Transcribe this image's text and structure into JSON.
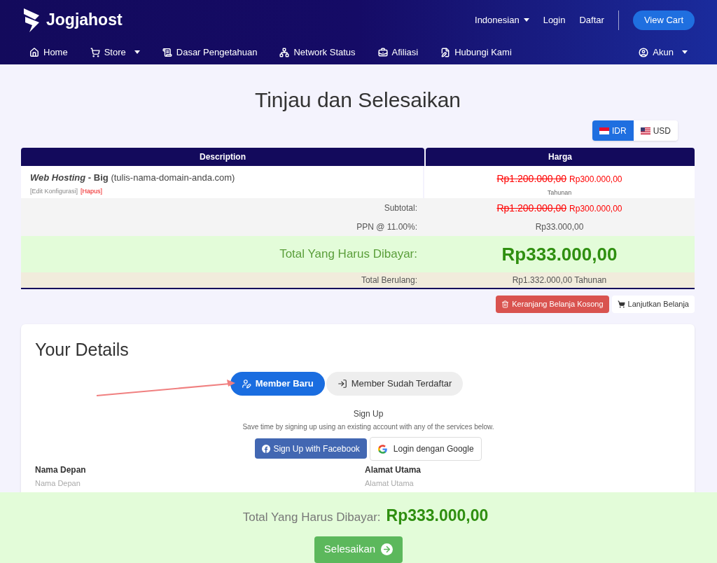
{
  "header": {
    "logo": "Jogjahost",
    "top_links": [
      {
        "label": "Indonesian",
        "dropdown": true
      },
      {
        "label": "Login",
        "dropdown": false
      },
      {
        "label": "Daftar",
        "dropdown": false
      }
    ],
    "view_cart": "View Cart"
  },
  "nav": {
    "items": [
      {
        "label": "Home",
        "kind": "home",
        "dropdown": false
      },
      {
        "label": "Store",
        "kind": "cart",
        "dropdown": true
      },
      {
        "label": "Dasar Pengetahuan",
        "kind": "scroll",
        "dropdown": false
      },
      {
        "label": "Network Status",
        "kind": "network",
        "dropdown": false
      },
      {
        "label": "Afiliasi",
        "kind": "briefcase",
        "dropdown": false
      },
      {
        "label": "Hubungi Kami",
        "kind": "edit",
        "dropdown": false
      }
    ],
    "account": {
      "label": "Akun",
      "dropdown": true
    }
  },
  "title": "Tinjau dan Selesaikan",
  "currencies": [
    {
      "label": "IDR",
      "selected": true,
      "kind": "id"
    },
    {
      "label": "USD",
      "selected": false,
      "kind": "us"
    }
  ],
  "table": {
    "columns": [
      "Description",
      "Harga"
    ],
    "item": {
      "name": "Web Hosting",
      "separator": "-",
      "variant": "Big",
      "domain": "(tulis-nama-domain-anda.com)",
      "edit": "[Edit Konfigurasi]",
      "remove": "[Hapus]",
      "old_price": "Rp1.200.000,00",
      "price": "Rp300.000,00",
      "cycle": "Tahunan"
    },
    "subtotal": {
      "label": "Subtotal:",
      "old_price": "Rp1.200.000,00",
      "price": "Rp300.000,00"
    },
    "tax": {
      "label": "PPN @ 11.00%:",
      "value": "Rp33.000,00"
    },
    "total": {
      "label": "Total Yang Harus Dibayar:",
      "value": "Rp333.000,00"
    },
    "recurring": {
      "label": "Total Berulang:",
      "value": "Rp1.332.000,00 Tahunan"
    }
  },
  "cart_actions": {
    "empty": "Keranjang Belanja Kosong",
    "continue": "Lanjutkan Belanja"
  },
  "details": {
    "title": "Your Details",
    "account_tabs": [
      {
        "label": "Member Baru",
        "selected": true,
        "kind": "new"
      },
      {
        "label": "Member Sudah Terdaftar",
        "selected": false,
        "kind": "login"
      }
    ],
    "signup_title": "Sign Up",
    "signup_text": "Save time by signing up using an existing account with any of the services below.",
    "facebook": "Sign Up with Facebook",
    "google": "Login dengan Google",
    "fields": [
      {
        "label": "Nama Depan",
        "placeholder": "Nama Depan"
      },
      {
        "label": "Alamat Utama",
        "placeholder": "Alamat Utama"
      }
    ]
  },
  "footer_bar": {
    "label": "Total Yang Harus Dibayar:",
    "value": "Rp333.000,00",
    "button": "Selesaikan"
  }
}
